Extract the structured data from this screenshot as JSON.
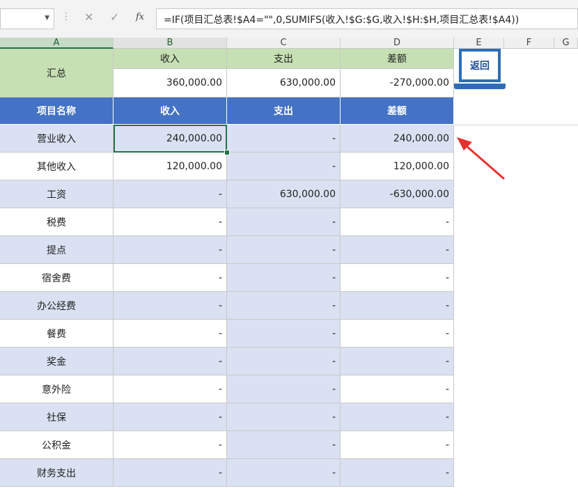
{
  "formula_bar": {
    "name_box": "",
    "cancel_icon": "✕",
    "enter_icon": "✓",
    "fx_label": "fx",
    "formula": "=IF(项目汇总表!$A4=\"\",0,SUMIFS(收入!$G:$G,收入!$H:$H,项目汇总表!$A4))"
  },
  "columns": [
    "A",
    "B",
    "C",
    "D",
    "E",
    "F",
    "G"
  ],
  "summary": {
    "label": "汇总",
    "headers": [
      "收入",
      "支出",
      "差额"
    ],
    "values": [
      "360,000.00",
      "630,000.00",
      "-270,000.00"
    ]
  },
  "table_header": [
    "项目名称",
    "收入",
    "支出",
    "差额"
  ],
  "rows": [
    [
      "营业收入",
      "240,000.00",
      "-",
      "240,000.00"
    ],
    [
      "其他收入",
      "120,000.00",
      "-",
      "120,000.00"
    ],
    [
      "工资",
      "-",
      "630,000.00",
      "-630,000.00"
    ],
    [
      "税费",
      "-",
      "-",
      "-"
    ],
    [
      "提点",
      "-",
      "-",
      "-"
    ],
    [
      "宿舍费",
      "-",
      "-",
      "-"
    ],
    [
      "办公经费",
      "-",
      "-",
      "-"
    ],
    [
      "餐费",
      "-",
      "-",
      "-"
    ],
    [
      "奖金",
      "-",
      "-",
      "-"
    ],
    [
      "意外险",
      "-",
      "-",
      "-"
    ],
    [
      "社保",
      "-",
      "-",
      "-"
    ],
    [
      "公积金",
      "-",
      "-",
      "-"
    ],
    [
      "财务支出",
      "-",
      "-",
      "-"
    ]
  ],
  "return_button": {
    "label": "返回"
  },
  "colors": {
    "summary_green": "#c6e0b4",
    "header_blue": "#4472c4",
    "band_blue": "#d9e1f2",
    "selection_green": "#217346",
    "annotation_red": "#e8322d"
  }
}
